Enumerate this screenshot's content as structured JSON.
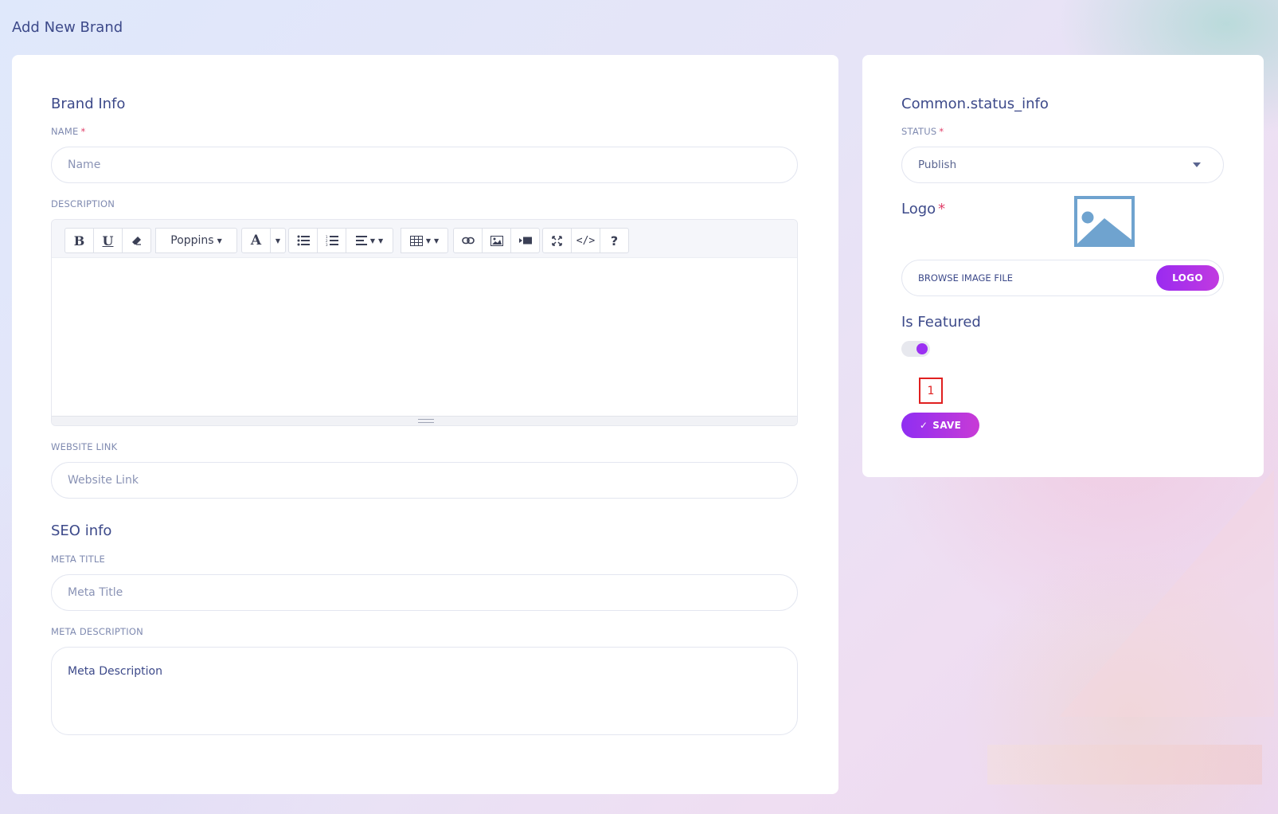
{
  "page": {
    "title": "Add New Brand"
  },
  "brand_info": {
    "title": "Brand Info",
    "name": {
      "label": "NAME",
      "placeholder": "Name"
    },
    "description": {
      "label": "DESCRIPTION"
    },
    "website": {
      "label": "WEBSITE LINK",
      "placeholder": "Website Link"
    }
  },
  "editor": {
    "font_family": "Poppins",
    "toolbar": [
      "bold",
      "underline",
      "eraser",
      "font-family",
      "font-color",
      "unordered-list",
      "ordered-list",
      "align",
      "table",
      "link",
      "image",
      "video",
      "fullscreen",
      "code-view",
      "help"
    ]
  },
  "seo": {
    "title": "SEO info",
    "meta_title": {
      "label": "META TITLE",
      "placeholder": "Meta Title"
    },
    "meta_description": {
      "label": "META DESCRIPTION",
      "placeholder": "Meta Description"
    }
  },
  "status_info": {
    "title": "Common.status_info",
    "status": {
      "label": "STATUS",
      "value": "Publish"
    },
    "logo": {
      "label": "Logo",
      "file_text": "BROWSE IMAGE FILE",
      "button": "LOGO"
    },
    "featured": {
      "label": "Is Featured",
      "on": true
    },
    "marker": "1",
    "save": {
      "label": "SAVE",
      "icon": "check-icon"
    }
  },
  "required_mark": "*",
  "colors": {
    "accent": "#9b30f2",
    "text": "#3d4a8a",
    "required": "#e0406a"
  }
}
